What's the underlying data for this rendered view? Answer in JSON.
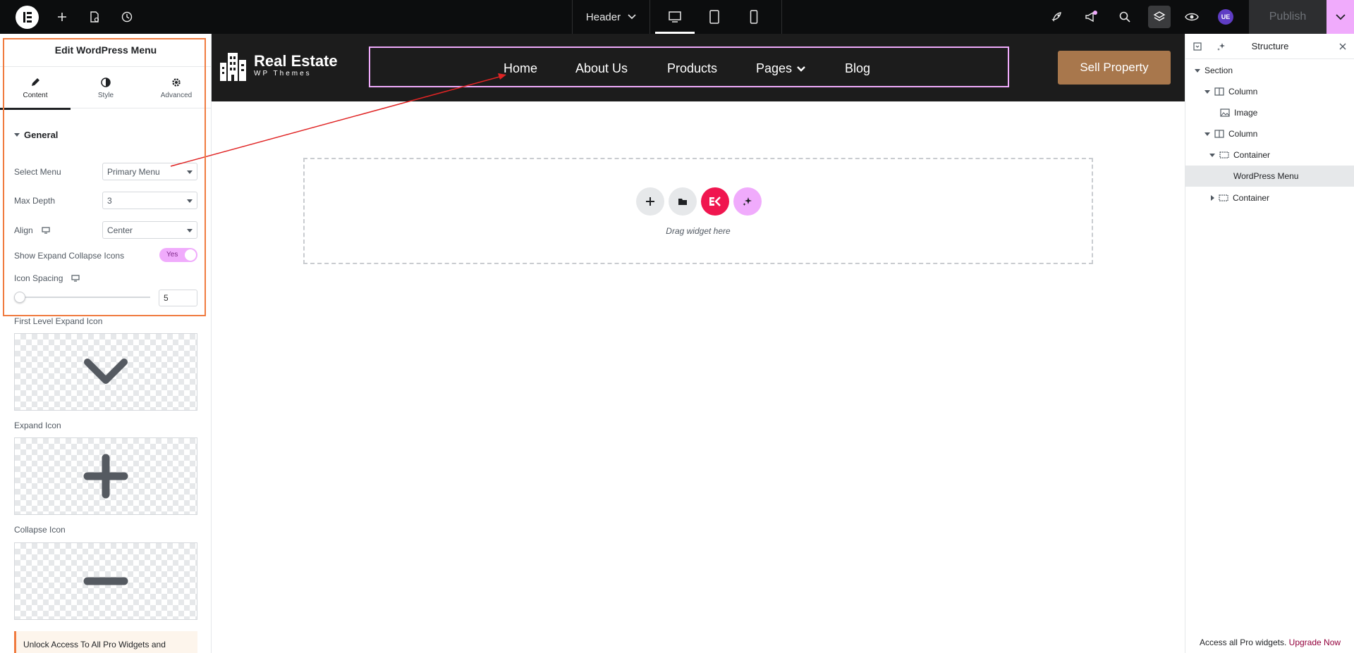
{
  "topbar": {
    "document_label": "Header",
    "publish_label": "Publish",
    "avatar_initials": "UE"
  },
  "left_panel": {
    "title": "Edit WordPress Menu",
    "tabs": [
      {
        "label": "Content",
        "icon": "pencil-icon"
      },
      {
        "label": "Style",
        "icon": "half-circle-icon"
      },
      {
        "label": "Advanced",
        "icon": "gear-icon"
      }
    ],
    "section": "General",
    "controls": {
      "select_menu": {
        "label": "Select Menu",
        "value": "Primary Menu"
      },
      "max_depth": {
        "label": "Max Depth",
        "value": "3"
      },
      "align": {
        "label": "Align",
        "value": "Center"
      },
      "show_icons": {
        "label": "Show Expand Collapse Icons",
        "value": "Yes"
      },
      "icon_spacing": {
        "label": "Icon Spacing",
        "value": "5"
      },
      "first_level_icon": {
        "label": "First Level Expand Icon"
      },
      "expand_icon": {
        "label": "Expand Icon"
      },
      "collapse_icon": {
        "label": "Collapse Icon"
      }
    },
    "promo_text": "Unlock Access To All Pro Widgets and"
  },
  "site_header": {
    "brand_name": "Real Estate",
    "brand_sub": "WP Themes",
    "nav": [
      "Home",
      "About Us",
      "Products",
      "Pages",
      "Blog"
    ],
    "cta": "Sell Property"
  },
  "dropzone": {
    "text": "Drag widget here"
  },
  "structure": {
    "title": "Structure",
    "tree": [
      {
        "label": "Section",
        "level": 0,
        "caret": "down",
        "icon": ""
      },
      {
        "label": "Column",
        "level": 1,
        "caret": "down",
        "icon": "column-icon"
      },
      {
        "label": "Image",
        "level": 2,
        "caret": "",
        "icon": "image-icon"
      },
      {
        "label": "Column",
        "level": 1,
        "caret": "down",
        "icon": "column-icon"
      },
      {
        "label": "Container",
        "level": 2,
        "caret": "down",
        "icon": "container-icon"
      },
      {
        "label": "WordPress Menu",
        "level": 3,
        "caret": "",
        "icon": "",
        "selected": true
      },
      {
        "label": "Container",
        "level": 2,
        "caret": "right",
        "icon": "container-icon"
      }
    ],
    "footer_text": "Access all Pro widgets.",
    "footer_link": "Upgrade Now"
  },
  "colors": {
    "accent_pink": "#f0abfc",
    "highlight_orange": "#f07b3f",
    "cta_brown": "#a8774c",
    "elementor_red": "#f0164f",
    "arrow_red": "#e02424"
  }
}
